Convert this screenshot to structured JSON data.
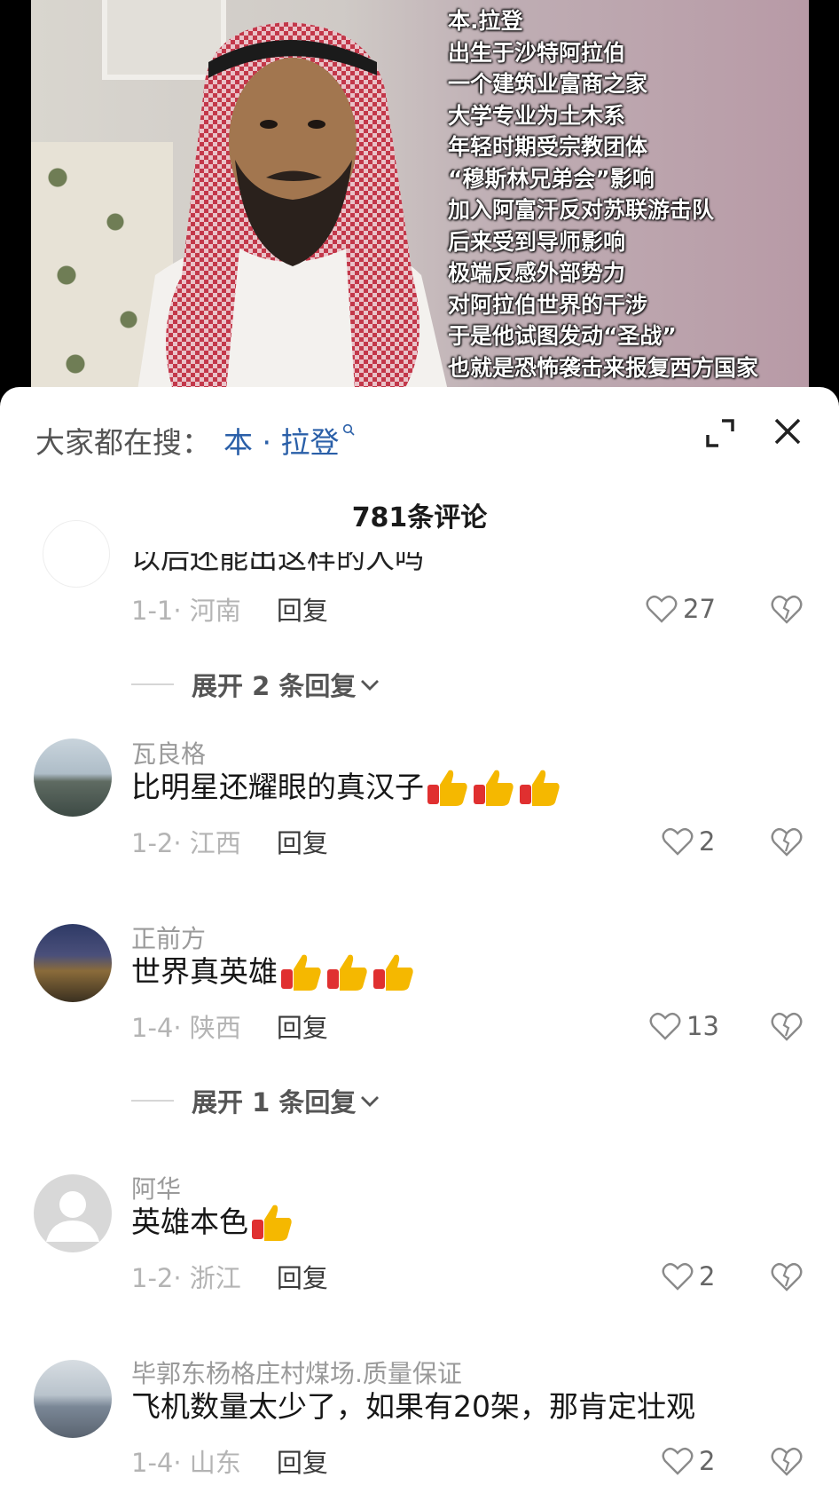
{
  "video": {
    "caption_lines": [
      "本.拉登",
      "出生于沙特阿拉伯",
      "一个建筑业富商之家",
      "大学专业为土木系",
      "年轻时期受宗教团体",
      "“穆斯林兄弟会”影响",
      "加入阿富汗反对苏联游击队",
      "后来受到导师影响",
      "极端反感外部势力",
      "对阿拉伯世界的干涉",
      "于是他试图发动“圣战”",
      "也就是恐怖袭击来报复西方国家"
    ]
  },
  "sheet": {
    "search_prefix": "大家都在搜：",
    "search_term": "本 · 拉登",
    "comment_count": "781条评论"
  },
  "cut_comment": {
    "partial_text": "以后还能出这样的人吗",
    "time_loc": "1-1· 河南",
    "reply_label": "回复",
    "likes": "27"
  },
  "expand_1": {
    "label": "展开 2 条回复"
  },
  "comments": [
    {
      "user": "瓦良格",
      "text": "比明星还耀眼的真汉子",
      "thumbs": 3,
      "time_loc": "1-2· 江西",
      "reply_label": "回复",
      "likes": "2"
    },
    {
      "user": "正前方",
      "text": "世界真英雄",
      "thumbs": 3,
      "time_loc": "1-4· 陕西",
      "reply_label": "回复",
      "likes": "13"
    },
    {
      "user": "阿华",
      "text": "英雄本色",
      "thumbs": 1,
      "time_loc": "1-2· 浙江",
      "reply_label": "回复",
      "likes": "2"
    },
    {
      "user": "毕郭东杨格庄村煤场.质量保证",
      "text": "飞机数量太少了，如果有20架，那肯定壮观",
      "thumbs": 0,
      "time_loc": "1-4· 山东",
      "reply_label": "回复",
      "likes": "2"
    }
  ],
  "expand_2": {
    "label": "展开 1 条回复"
  },
  "colors": {
    "search_term": "#2a5fa8",
    "meta_gray": "#b4b4b4",
    "thumb_yellow": "#f5b800",
    "thumb_red": "#e03030"
  }
}
